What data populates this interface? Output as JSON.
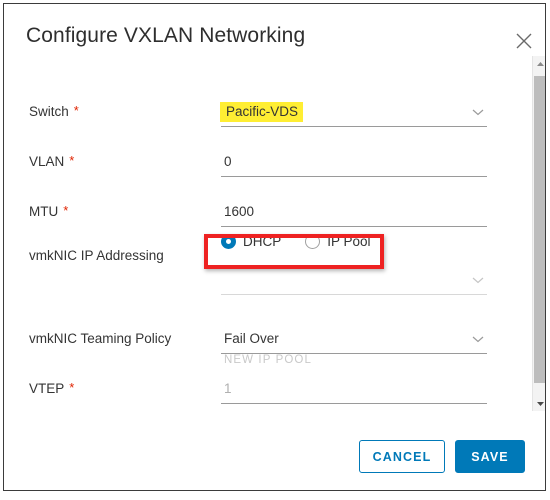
{
  "dialog": {
    "title": "Configure VXLAN Networking",
    "close_icon": "close-icon"
  },
  "form": {
    "fields": [
      {
        "label": "Switch",
        "required": "*",
        "type": "select",
        "value": "Pacific-VDS",
        "highlighted": true
      },
      {
        "label": "VLAN",
        "required": "*",
        "type": "text",
        "value": "0"
      },
      {
        "label": "MTU",
        "required": "*",
        "type": "text",
        "value": "1600"
      },
      {
        "label": "vmkNIC IP Addressing",
        "required": "",
        "type": "radio-group"
      },
      {
        "label": "vmkNIC Teaming Policy",
        "required": "",
        "type": "select",
        "value": "Fail Over"
      },
      {
        "label": "VTEP",
        "required": "*",
        "type": "text",
        "value": "1",
        "is_placeholder": true
      }
    ],
    "ip_addressing": {
      "options": [
        {
          "label": "DHCP",
          "selected": true
        },
        {
          "label": "IP Pool",
          "selected": false
        }
      ]
    },
    "ip_pool_select": {
      "value": "",
      "disabled": true
    },
    "new_ip_pool_caption": "NEW IP POOL"
  },
  "footer": {
    "cancel_label": "CANCEL",
    "save_label": "SAVE"
  },
  "colors": {
    "accent": "#0079b8",
    "required_asterisk": "#e02200",
    "highlight": "#ffee33",
    "annotation": "#ee2222",
    "text": "#343434"
  },
  "scrollbar": {
    "up_icon": "caret-up-icon",
    "down_icon": "caret-down-icon"
  }
}
